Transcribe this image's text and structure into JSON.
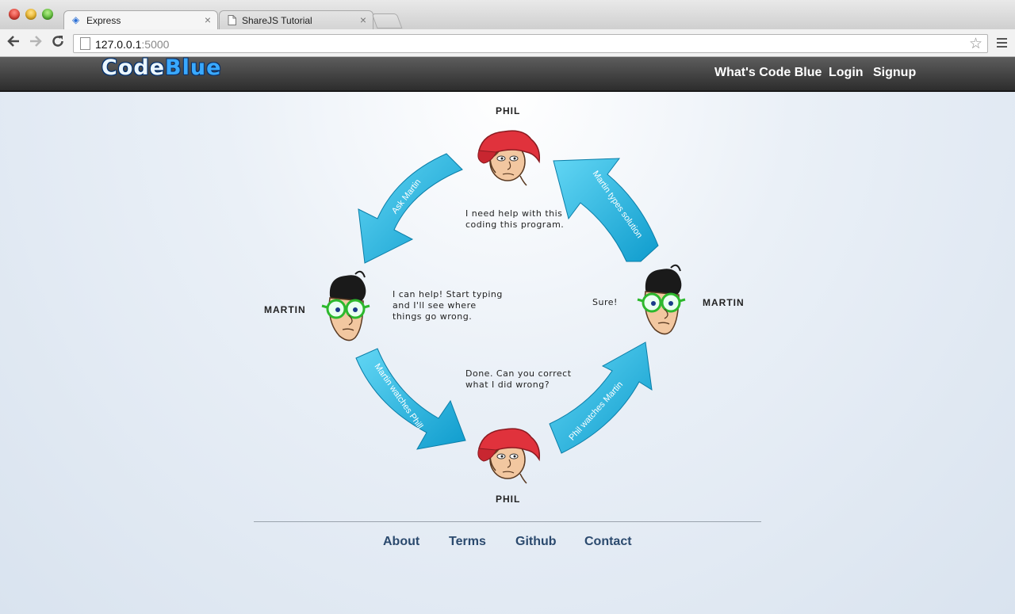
{
  "browser": {
    "tabs": [
      {
        "label": "Express",
        "icon": "express-favicon"
      },
      {
        "label": "ShareJS Tutorial",
        "icon": "page-icon"
      }
    ],
    "url_host": "127.0.0.1",
    "url_port": ":5000"
  },
  "site": {
    "logo_code": "Code",
    "logo_blue": "Blue",
    "nav": [
      "What's Code Blue",
      "Login",
      "Signup"
    ]
  },
  "diagram": {
    "people": {
      "phil_top": "PHIL",
      "martin_left": "MARTIN",
      "martin_right": "MARTIN",
      "phil_bottom": "PHIL"
    },
    "speech": {
      "phil_top": [
        "I need help with this",
        "coding this program."
      ],
      "martin_left": [
        "I can help! Start typing",
        "and I'll see where",
        "things go wrong."
      ],
      "martin_right": [
        "Sure!"
      ],
      "phil_bottom": [
        "Done. Can you correct",
        "what I did wrong?"
      ]
    },
    "arrows": {
      "top_left": "Ask Martin",
      "top_right": "Martin types solution",
      "bottom_left": "Martin watches Phill",
      "bottom_right": "Phil watches Martin"
    }
  },
  "footer": {
    "links": [
      "About",
      "Terms",
      "Github",
      "Contact"
    ]
  },
  "colors": {
    "arrow": "#1aa9d8",
    "arrow_light": "#5fd3f2",
    "header_dark": "#2d2d2d",
    "footer_link": "#2b4a6e",
    "hat_red": "#e0323c",
    "glasses_green": "#2db82d"
  }
}
